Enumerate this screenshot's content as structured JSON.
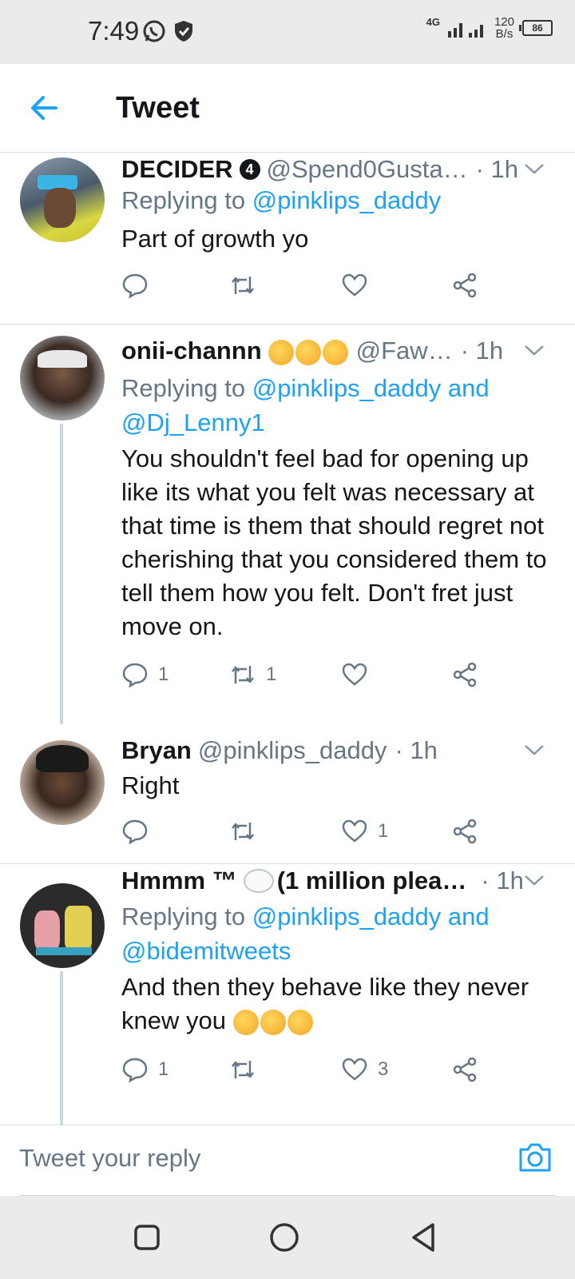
{
  "status_bar": {
    "time": "7:49",
    "network": "4G",
    "speed_value": "120",
    "speed_unit": "B/s",
    "battery": "86"
  },
  "header": {
    "title": "Tweet"
  },
  "tweets": [
    {
      "name": "DECIDER",
      "badge": "4",
      "handle": "@Spend0Gusta…",
      "time": "· 1h",
      "replying_prefix": "Replying to ",
      "mentions": "@pinklips_daddy",
      "mentions2": "",
      "text": "Part of growth yo",
      "reply_count": "",
      "retweet_count": "",
      "like_count": ""
    },
    {
      "name": "onii-channn",
      "handle": "@Faw…",
      "time": "· 1h",
      "replying_prefix": "Replying to ",
      "mentions": "@pinklips_daddy and",
      "mentions2": "@Dj_Lenny1",
      "text": "You shouldn't feel bad for opening up like its what you felt was necessary at that time is them that should regret not cherishing that you considered them to tell them how you felt. Don't fret just move on.",
      "reply_count": "1",
      "retweet_count": "1",
      "like_count": ""
    },
    {
      "name": "Bryan",
      "handle": "@pinklips_daddy",
      "time": "· 1h",
      "text": "Right",
      "reply_count": "",
      "retweet_count": "",
      "like_count": "1"
    },
    {
      "name": "Hmmm ™",
      "name_suffix": "(1 million plea…",
      "time": "· 1h",
      "replying_prefix": "Replying to ",
      "mentions": "@pinklips_daddy and",
      "mentions2": "@bidemitweets",
      "text": "And then they behave like they never knew you",
      "reply_count": "1",
      "retweet_count": "",
      "like_count": "3"
    }
  ],
  "reply_box": {
    "placeholder": "Tweet your reply"
  },
  "icons": {
    "back": "arrow-left-icon",
    "caret": "chevron-down-icon",
    "reply": "reply-icon",
    "retweet": "retweet-icon",
    "like": "heart-icon",
    "share": "share-icon",
    "camera": "camera-icon"
  },
  "colors": {
    "accent": "#1da1f2",
    "secondary_text": "#657786",
    "divider": "#d9dee2"
  }
}
